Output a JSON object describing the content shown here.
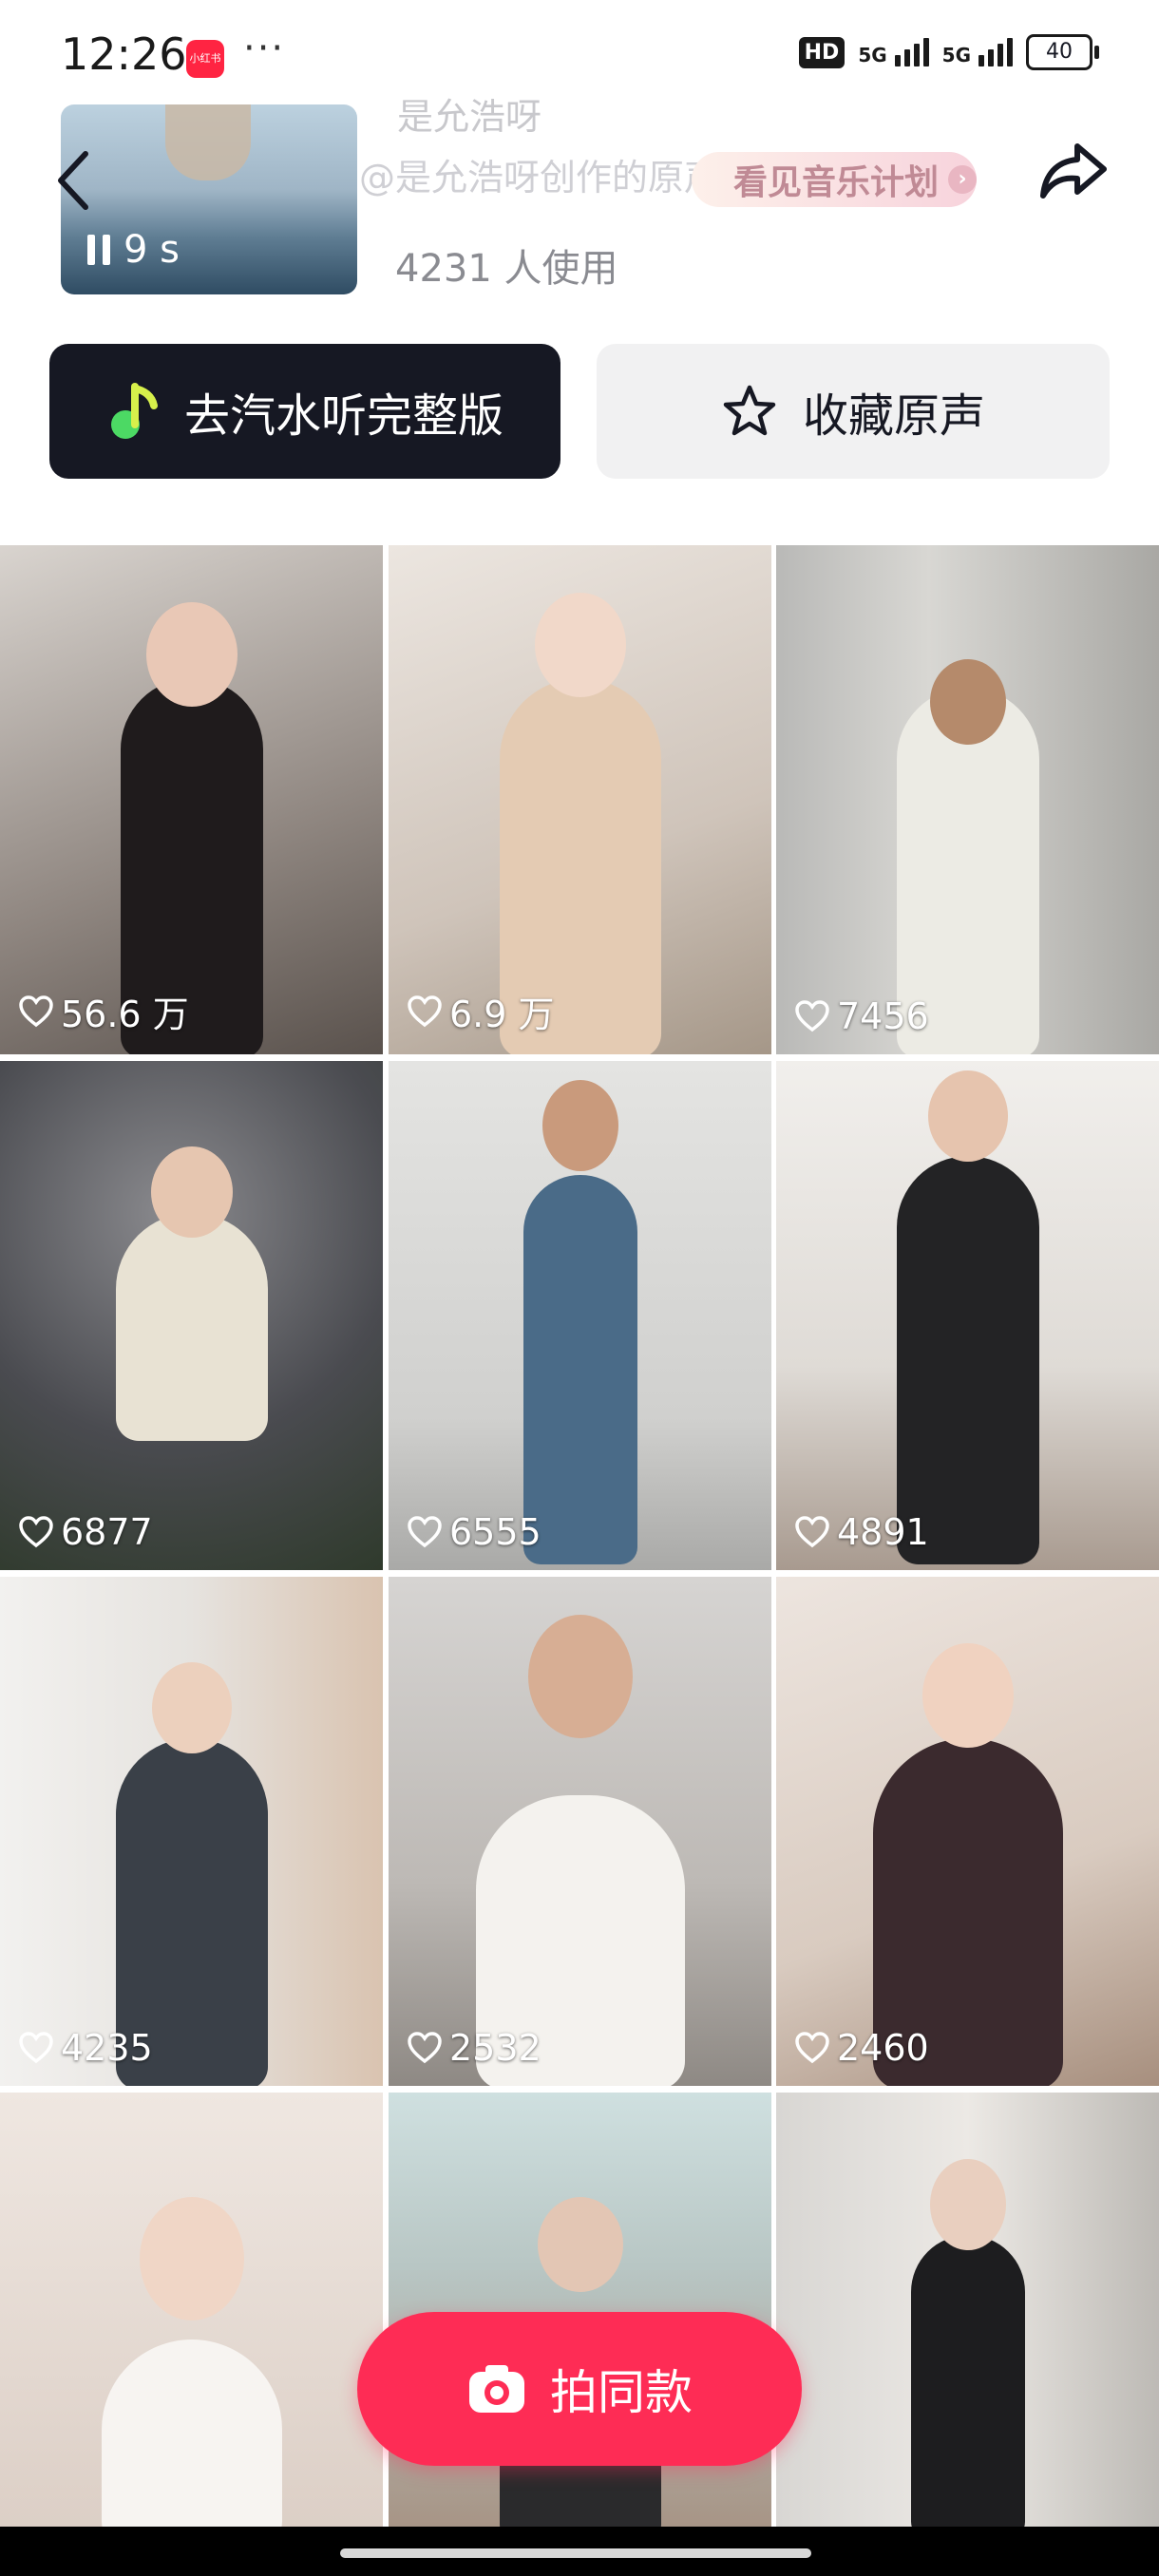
{
  "status_bar": {
    "time": "12:26",
    "app_icon_text": "小红书",
    "more": "···",
    "hd": "HD",
    "network_1": "5G",
    "network_2": "5G",
    "battery": "40"
  },
  "music": {
    "author": "是允浩呀",
    "subtitle": "@是允浩呀创作的原声",
    "plan_label": "看见音乐计划",
    "duration": "9 s",
    "use_count": "4231 人使用"
  },
  "actions": {
    "listen_full": "去汽水听完整版",
    "collect": "收藏原声"
  },
  "videos": [
    {
      "likes": "56.6 万"
    },
    {
      "likes": "6.9 万"
    },
    {
      "likes": "7456"
    },
    {
      "likes": "6877"
    },
    {
      "likes": "6555"
    },
    {
      "likes": "4891"
    },
    {
      "likes": "4235"
    },
    {
      "likes": "2532"
    },
    {
      "likes": "2460"
    },
    {
      "likes": ""
    },
    {
      "likes": ""
    },
    {
      "likes": ""
    }
  ],
  "shoot_button": {
    "label": "拍同款"
  },
  "colors": {
    "primary": "#fe2c55",
    "dark_button": "#161823",
    "light_button": "#f1f1f2",
    "qishui_green": "#4cd964"
  },
  "icons": [
    "back-arrow-icon",
    "share-icon",
    "pause-icon",
    "qishui-music-icon",
    "star-icon",
    "heart-icon",
    "camera-icon"
  ]
}
